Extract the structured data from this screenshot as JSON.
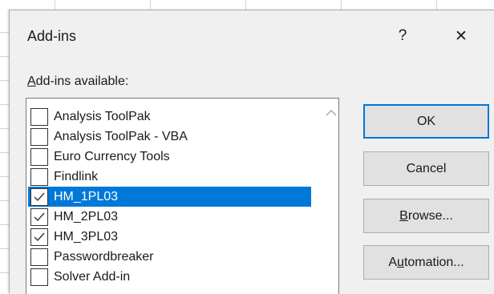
{
  "dialog": {
    "title": "Add-ins",
    "help_glyph": "?",
    "close_glyph": "✕"
  },
  "list": {
    "label_accel": "A",
    "label_rest": "dd-ins available:",
    "items": [
      {
        "label": "Analysis ToolPak",
        "checked": false,
        "selected": false
      },
      {
        "label": "Analysis ToolPak - VBA",
        "checked": false,
        "selected": false
      },
      {
        "label": "Euro Currency Tools",
        "checked": false,
        "selected": false
      },
      {
        "label": "Findlink",
        "checked": false,
        "selected": false
      },
      {
        "label": "HM_1PL03",
        "checked": true,
        "selected": true
      },
      {
        "label": "HM_2PL03",
        "checked": true,
        "selected": false
      },
      {
        "label": "HM_3PL03",
        "checked": true,
        "selected": false
      },
      {
        "label": "Passwordbreaker",
        "checked": false,
        "selected": false
      },
      {
        "label": "Solver Add-in",
        "checked": false,
        "selected": false
      }
    ]
  },
  "buttons": {
    "ok": "OK",
    "cancel": "Cancel",
    "browse_accel": "B",
    "browse_rest": "rowse...",
    "automation_pre": "A",
    "automation_accel": "u",
    "automation_rest": "tomation..."
  },
  "colors": {
    "selection": "#0078d7",
    "dialog_bg": "#f0f0f0",
    "button_bg": "#e1e1e1"
  }
}
